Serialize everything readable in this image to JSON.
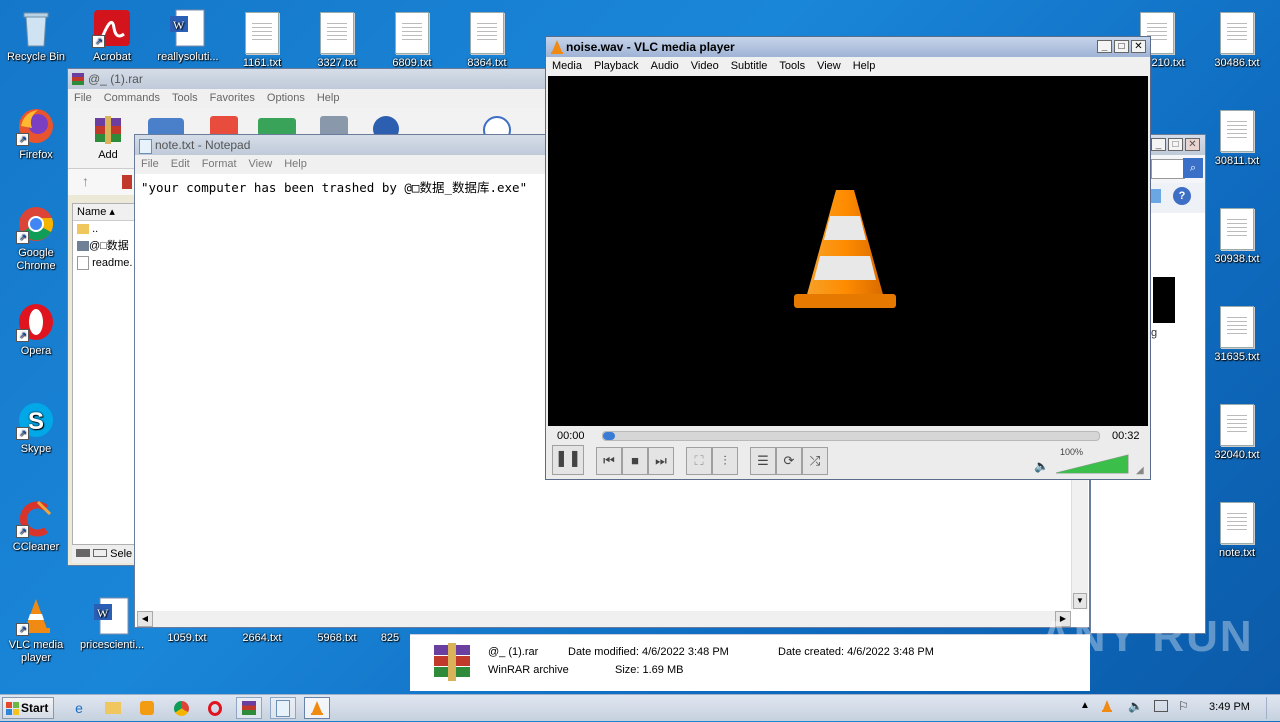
{
  "desktop": {
    "icons_left": [
      {
        "label": "Recycle Bin",
        "icon": "recycle-bin-icon"
      },
      {
        "label": "Acrobat",
        "icon": "acrobat-icon"
      },
      {
        "label": "reallysoluti...",
        "icon": "word-doc-icon"
      },
      {
        "label": "Firefox",
        "icon": "firefox-icon"
      },
      {
        "label": "Google Chrome",
        "icon": "chrome-icon"
      },
      {
        "label": "Opera",
        "icon": "opera-icon"
      },
      {
        "label": "Skype",
        "icon": "skype-icon"
      },
      {
        "label": "CCleaner",
        "icon": "ccleaner-icon"
      },
      {
        "label": "VLC media player",
        "icon": "vlc-icon"
      },
      {
        "label": "pricescienti...",
        "icon": "word-doc-icon"
      }
    ],
    "top_files": [
      "1161.txt",
      "3327.txt",
      "6809.txt",
      "8364.txt",
      "1",
      "210.txt",
      "30486.txt"
    ],
    "right_files": [
      "30811.txt",
      "30938.txt",
      "31635.txt",
      "32040.txt",
      "note.txt"
    ],
    "bottom_files": [
      "1059.txt",
      "2664.txt",
      "5968.txt",
      "825"
    ]
  },
  "winrar": {
    "title": "@_ (1).rar",
    "menu": [
      "File",
      "Commands",
      "Tools",
      "Favorites",
      "Options",
      "Help"
    ],
    "add_label": "Add",
    "col_name": "Name",
    "rows": [
      "..",
      "@□数据",
      "readme."
    ],
    "status": "Sele"
  },
  "notepad": {
    "title": "note.txt - Notepad",
    "menu": [
      "File",
      "Edit",
      "Format",
      "View",
      "Help"
    ],
    "content": "\"your computer has been trashed by @□数据_数据库.exe\""
  },
  "vlc": {
    "title": "noise.wav - VLC media player",
    "menu": [
      "Media",
      "Playback",
      "Audio",
      "Video",
      "Subtitle",
      "Tools",
      "View",
      "Help"
    ],
    "time_elapsed": "00:00",
    "time_total": "00:32",
    "progress": 0.01,
    "volume_label": "100%",
    "volume": 1.0
  },
  "explorer_details": {
    "file_name": "@_ (1).rar",
    "file_type": "WinRAR archive",
    "date_modified": "Date modified: 4/6/2022 3:48 PM",
    "size": "Size: 1.69 MB",
    "date_created": "Date created: 4/6/2022 3:48 PM",
    "partial_text": "g"
  },
  "taskbar": {
    "start_label": "Start",
    "clock": "3:49 PM",
    "apps": [
      "ie-icon",
      "explorer-icon",
      "media-player-icon",
      "chrome-icon",
      "opera-icon",
      "winrar-icon",
      "notepad-icon",
      "vlc-icon"
    ]
  },
  "watermark": "ANY RUN",
  "colors": {
    "vlc_orange": "#f08a12",
    "desktop_blue": "#1577c9",
    "progress_blue": "#3a7bd5"
  }
}
